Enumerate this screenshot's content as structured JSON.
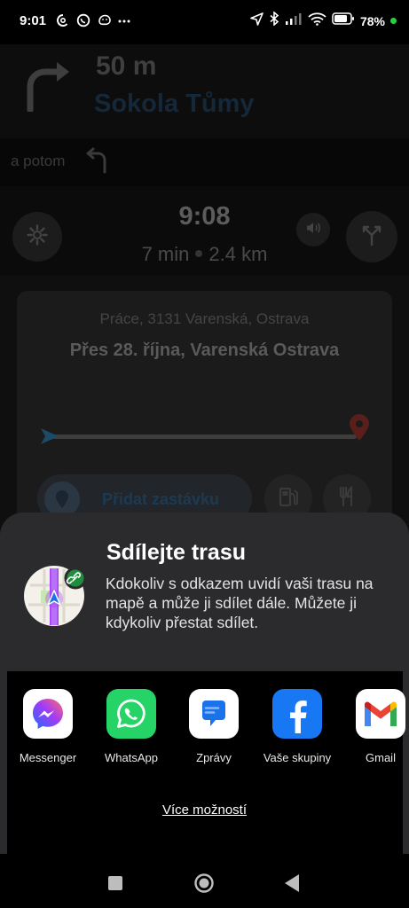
{
  "status_bar": {
    "time": "9:01",
    "battery": "78%",
    "notification_icons": [
      "threads-icon",
      "whatsapp-icon",
      "waze-icon",
      "more-dots-icon"
    ],
    "system_icons": [
      "location-arrow-icon",
      "bluetooth-icon",
      "signal-icon",
      "wifi-icon",
      "battery-icon"
    ]
  },
  "navigation": {
    "distance": "50 m",
    "street": "Sokola Tůmy",
    "then_label": "a potom"
  },
  "eta": {
    "arrival_time": "9:08",
    "duration": "7 min",
    "distance": "2.4 km"
  },
  "route": {
    "destination": "Práce, 3131 Varenská, Ostrava",
    "via": "Přes 28. října, Varenská Ostrava",
    "add_stop_label": "Přidat zastávku"
  },
  "share_sheet": {
    "title": "Sdílejte trasu",
    "description": "Kdokoliv s odkazem uvidí vaši trasu na mapě a může ji sdílet dále. Můžete ji kdykoliv přestat sdílet.",
    "apps": [
      {
        "label": "Messenger"
      },
      {
        "label": "WhatsApp"
      },
      {
        "label": "Zprávy"
      },
      {
        "label": "Vaše skupiny"
      },
      {
        "label": "Gmail"
      }
    ],
    "more_label": "Více možností"
  },
  "colors": {
    "sheet_bg": "#2b2b2d",
    "whatsapp_green": "#25d366",
    "facebook_blue": "#1877f2",
    "messages_blue": "#1a73e8",
    "destination_red": "#c6362b"
  }
}
